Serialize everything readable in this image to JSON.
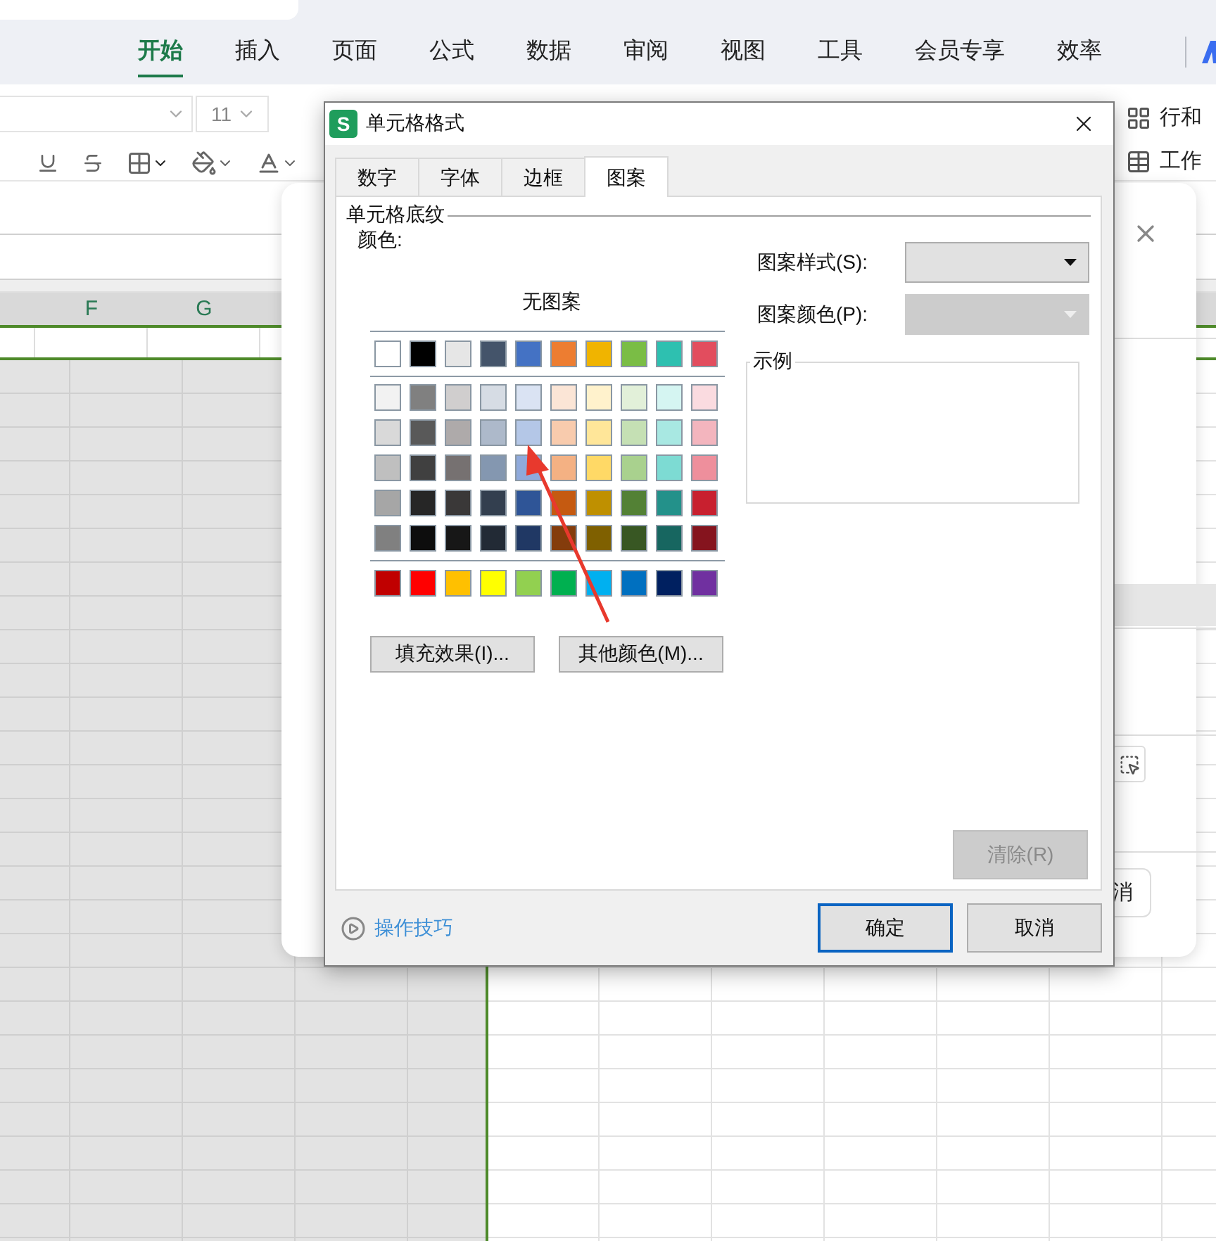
{
  "ribbon_tabs": [
    {
      "label": "开始",
      "selected": true
    },
    {
      "label": "插入",
      "selected": false
    },
    {
      "label": "页面",
      "selected": false
    },
    {
      "label": "公式",
      "selected": false
    },
    {
      "label": "数据",
      "selected": false
    },
    {
      "label": "审阅",
      "selected": false
    },
    {
      "label": "视图",
      "selected": false
    },
    {
      "label": "工具",
      "selected": false
    },
    {
      "label": "会员专享",
      "selected": false
    },
    {
      "label": "效率",
      "selected": false
    }
  ],
  "toolbar": {
    "font_size": "11",
    "row_col_button": "行和",
    "sheet_button": "工作"
  },
  "columns": [
    "F",
    "G"
  ],
  "background_dialog": {
    "cancel_button": "消"
  },
  "dialog": {
    "app_icon": "S",
    "title": "单元格格式",
    "tabs": [
      {
        "label": "数字",
        "selected": false
      },
      {
        "label": "字体",
        "selected": false
      },
      {
        "label": "边框",
        "selected": false
      },
      {
        "label": "图案",
        "selected": true
      }
    ],
    "group_title": "单元格底纹",
    "color_label": "颜色:",
    "no_pattern": "无图案",
    "theme_colors": [
      {
        "color": "#ffffff"
      },
      {
        "color": "#000000"
      },
      {
        "color": "#e6e6e6"
      },
      {
        "color": "#44546a"
      },
      {
        "color": "#4472c4"
      },
      {
        "color": "#ed7d31"
      },
      {
        "color": "#f0b400"
      },
      {
        "color": "#7abd45"
      },
      {
        "color": "#2ec0b0"
      },
      {
        "color": "#e24d5e"
      }
    ],
    "shades": [
      [
        {
          "color": "#f2f2f2"
        },
        {
          "color": "#808080"
        },
        {
          "color": "#d0cece"
        },
        {
          "color": "#d6dce4"
        },
        {
          "color": "#dae3f3"
        },
        {
          "color": "#fbe5d6"
        },
        {
          "color": "#fff2cc"
        },
        {
          "color": "#e2f0d9"
        },
        {
          "color": "#d5f5f2"
        },
        {
          "color": "#fadbe0"
        }
      ],
      [
        {
          "color": "#d9d9d9"
        },
        {
          "color": "#595959"
        },
        {
          "color": "#aeaaaa"
        },
        {
          "color": "#adb9ca"
        },
        {
          "color": "#b4c7e7"
        },
        {
          "color": "#f8cbad"
        },
        {
          "color": "#ffe699"
        },
        {
          "color": "#c5e0b4"
        },
        {
          "color": "#a8e8e2"
        },
        {
          "color": "#f3b5be"
        }
      ],
      [
        {
          "color": "#bfbfbf"
        },
        {
          "color": "#404040"
        },
        {
          "color": "#767171"
        },
        {
          "color": "#8497b0"
        },
        {
          "color": "#8faadc"
        },
        {
          "color": "#f4b183"
        },
        {
          "color": "#ffd966"
        },
        {
          "color": "#a9d18e"
        },
        {
          "color": "#7ddbd3"
        },
        {
          "color": "#ee8f9c"
        }
      ],
      [
        {
          "color": "#a6a6a6"
        },
        {
          "color": "#262626"
        },
        {
          "color": "#3a3838"
        },
        {
          "color": "#333f4f"
        },
        {
          "color": "#2f5597"
        },
        {
          "color": "#c55a11"
        },
        {
          "color": "#bf9000"
        },
        {
          "color": "#538135"
        },
        {
          "color": "#23918a"
        },
        {
          "color": "#c8202f"
        }
      ],
      [
        {
          "color": "#808080"
        },
        {
          "color": "#0d0d0d"
        },
        {
          "color": "#171717"
        },
        {
          "color": "#222a35"
        },
        {
          "color": "#203864"
        },
        {
          "color": "#843c0c"
        },
        {
          "color": "#7f6000"
        },
        {
          "color": "#385723"
        },
        {
          "color": "#176660"
        },
        {
          "color": "#85141e"
        }
      ]
    ],
    "standard_colors": [
      {
        "color": "#c00000"
      },
      {
        "color": "#ff0000"
      },
      {
        "color": "#ffc000"
      },
      {
        "color": "#ffff00"
      },
      {
        "color": "#92d050"
      },
      {
        "color": "#00b050"
      },
      {
        "color": "#00b0f0"
      },
      {
        "color": "#0070c0"
      },
      {
        "color": "#002060"
      },
      {
        "color": "#7030a0"
      }
    ],
    "fill_effects_button": "填充效果(I)...",
    "more_colors_button": "其他颜色(M)...",
    "pattern_style_label": "图案样式(S):",
    "pattern_color_label": "图案颜色(P):",
    "pattern_color_disabled": true,
    "sample_label": "示例",
    "clear_button": {
      "label": "清除(R)",
      "disabled": true
    },
    "tips_link": "操作技巧",
    "ok_button": "确定",
    "cancel_button": "取消"
  }
}
